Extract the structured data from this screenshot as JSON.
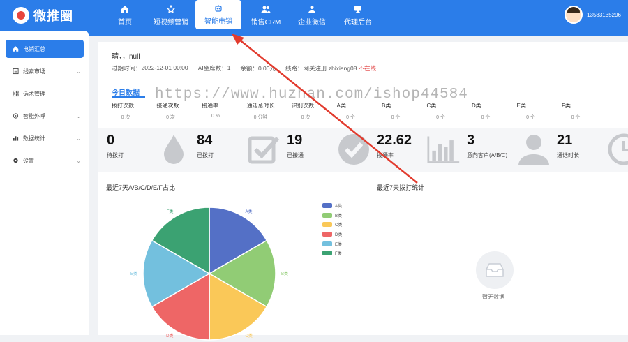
{
  "brand": {
    "name": "微推圈",
    "color": "#2b7de9"
  },
  "nav": [
    {
      "label": "首页",
      "icon": "home-icon"
    },
    {
      "label": "短视频营销",
      "icon": "star-icon"
    },
    {
      "label": "智能电销",
      "icon": "robot-icon"
    },
    {
      "label": "销售CRM",
      "icon": "people-icon"
    },
    {
      "label": "企业微信",
      "icon": "person-icon"
    },
    {
      "label": "代理后台",
      "icon": "monitor-icon"
    }
  ],
  "nav_active_index": 2,
  "user": {
    "phone": "13583135296"
  },
  "sidebar": [
    {
      "label": "电销汇总",
      "icon": "home-icon",
      "active": true,
      "chevron": false
    },
    {
      "label": "线索市场",
      "icon": "list-icon",
      "active": false,
      "chevron": true
    },
    {
      "label": "话术管理",
      "icon": "grid-icon",
      "active": false,
      "chevron": false
    },
    {
      "label": "智能外呼",
      "icon": "phone-icon",
      "active": false,
      "chevron": true
    },
    {
      "label": "数据统计",
      "icon": "bar-chart-icon",
      "active": false,
      "chevron": true
    },
    {
      "label": "设置",
      "icon": "gear-icon",
      "active": false,
      "chevron": true
    }
  ],
  "greeting": "晴，，null",
  "info": {
    "expire_label": "过期时间：",
    "expire_value": "2022-12-01 00:00",
    "ai_label": "AI坐席数：",
    "ai_value": "1",
    "balance_label": "余额：",
    "balance_value": "0.00元",
    "line_label": "线路：",
    "line_value": "网关注册 zhixiang08",
    "line_status": "不在线"
  },
  "today": {
    "title": "今日数据",
    "columns": [
      {
        "label": "拨打次数",
        "value": "0 次"
      },
      {
        "label": "接通次数",
        "value": "0 次"
      },
      {
        "label": "接通率",
        "value": "0 %"
      },
      {
        "label": "通话总时长",
        "value": "0 分钟"
      },
      {
        "label": "识别次数",
        "value": "0 次"
      },
      {
        "label": "A类",
        "value": "0 个"
      },
      {
        "label": "B类",
        "value": "0 个"
      },
      {
        "label": "C类",
        "value": "0 个"
      },
      {
        "label": "D类",
        "value": "0 个"
      },
      {
        "label": "E类",
        "value": "0 个"
      },
      {
        "label": "F类",
        "value": "0 个"
      }
    ]
  },
  "kpis": [
    {
      "value": "0",
      "label": "待拨打",
      "icon": "water-drop-icon"
    },
    {
      "value": "84",
      "label": "已拨打",
      "icon": "checkbox-icon"
    },
    {
      "value": "19",
      "label": "已接通",
      "icon": "check-circle-icon"
    },
    {
      "value": "22.62",
      "label": "接通率",
      "icon": "bar-chart-icon"
    },
    {
      "value": "3",
      "label": "意向客户(A/B/C)",
      "icon": "user-icon"
    },
    {
      "value": "21",
      "label": "通话时长",
      "icon": "clock-icon"
    }
  ],
  "pie_panel": {
    "title": "最近7天A/B/C/D/E/F占比"
  },
  "line_panel": {
    "title": "最近7天拨打统计",
    "empty_text": "暂无数据"
  },
  "watermark": "https://www.huzhan.com/ishop44584",
  "chart_data": {
    "type": "pie",
    "title": "最近7天A/B/C/D/E/F占比",
    "categories": [
      "A类",
      "B类",
      "C类",
      "D类",
      "E类",
      "F类"
    ],
    "values": [
      1,
      1,
      1,
      1,
      1,
      1
    ],
    "colors": [
      "#5470c6",
      "#91cc75",
      "#fac858",
      "#ee6666",
      "#73c0de",
      "#3ba272"
    ],
    "legend": "top-right"
  }
}
